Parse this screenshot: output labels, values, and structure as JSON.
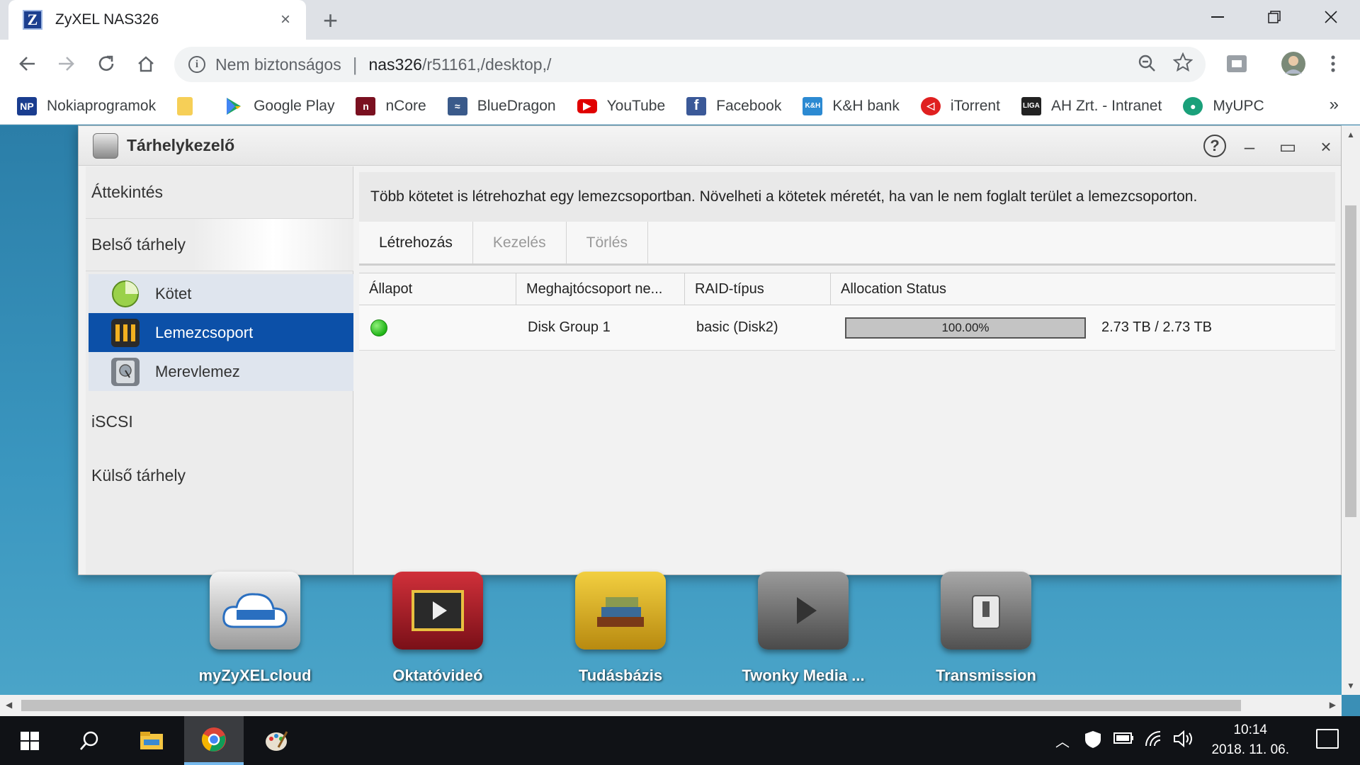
{
  "browser": {
    "tab_title": "ZyXEL NAS326",
    "favicon_letter": "Z",
    "tab_close": "×",
    "new_tab": "+",
    "security_label": "Nem biztonságos",
    "url_host": "nas326",
    "url_path": "/r51161,/desktop,/",
    "bookmarks": [
      {
        "label": "Nokiaprogramok",
        "icon": "nokiaprogramok-icon",
        "color": "#1a3d8f"
      },
      {
        "label": "",
        "icon": "folder-icon",
        "color": "#f6cf57"
      },
      {
        "label": "Google Play",
        "icon": "google-play-icon",
        "color": "#1fa463"
      },
      {
        "label": "nCore",
        "icon": "ncore-icon",
        "color": "#7a1020"
      },
      {
        "label": "BlueDragon",
        "icon": "bluedragon-icon",
        "color": "#3a5a8a"
      },
      {
        "label": "YouTube",
        "icon": "youtube-icon",
        "color": "#e00000"
      },
      {
        "label": "Facebook",
        "icon": "facebook-icon",
        "color": "#3b5998"
      },
      {
        "label": "K&H bank",
        "icon": "kh-bank-icon",
        "color": "#2c8ad2"
      },
      {
        "label": "iTorrent",
        "icon": "itorrent-icon",
        "color": "#e02020"
      },
      {
        "label": "AH Zrt. - Intranet",
        "icon": "liga-icon",
        "color": "#222222"
      },
      {
        "label": "MyUPC",
        "icon": "myupc-icon",
        "color": "#1aa07a"
      }
    ],
    "bookmarks_more": "»"
  },
  "window": {
    "title": "Tárhelykezelő",
    "help_label": "?",
    "minimize_label": "–",
    "maximize_label": "▭",
    "close_label": "×"
  },
  "sidebar": {
    "overview": "Áttekintés",
    "internal": "Belső tárhely",
    "sub_items": [
      {
        "label": "Kötet",
        "icon": "volume-pie-icon"
      },
      {
        "label": "Lemezcsoport",
        "icon": "disk-group-icon"
      },
      {
        "label": "Merevlemez",
        "icon": "hard-disk-icon"
      }
    ],
    "iscsi": "iSCSI",
    "external": "Külső tárhely"
  },
  "main": {
    "description": "Több kötetet is létrehozhat egy lemezcsoportban. Növelheti a kötetek méretét, ha van le nem foglalt terület a lemezcsoporton.",
    "tabs": [
      "Létrehozás",
      "Kezelés",
      "Törlés"
    ],
    "columns": [
      "Állapot",
      "Meghajtócsoport ne...",
      "RAID-típus",
      "Allocation Status"
    ],
    "rows": [
      {
        "status": "ok",
        "name": "Disk Group 1",
        "raid": "basic (Disk2)",
        "alloc_percent": 100.0,
        "alloc_text": "100.00%",
        "capacity": "2.73 TB / 2.73 TB"
      }
    ]
  },
  "apps": [
    {
      "label": "myZyXELcloud",
      "icon": "zyxel-cloud-icon"
    },
    {
      "label": "Oktatóvideó",
      "icon": "video-tutorial-icon"
    },
    {
      "label": "Tudásbázis",
      "icon": "books-icon"
    },
    {
      "label": "Twonky Media ...",
      "icon": "twonky-media-icon"
    },
    {
      "label": "Transmission",
      "icon": "transmission-icon"
    }
  ],
  "taskbar": {
    "time": "10:14",
    "date": "2018. 11. 06."
  },
  "colors": {
    "selected_nav": "#0c50a8",
    "status_ok": "#1fb416"
  }
}
